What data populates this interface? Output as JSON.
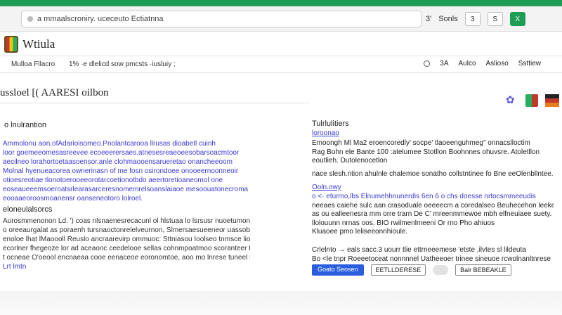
{
  "browser": {
    "address": "a mmaalscroniry. uceceuto Ectiatnna",
    "right_labels": [
      "3'",
      "Sonls",
      "3",
      "S",
      "X"
    ]
  },
  "header": {
    "site_name": "Wtiula"
  },
  "nav": {
    "items": [
      "Mulloa Fllacro",
      "1% ·e dlelicd sow pmcsts ·iusluiy ;"
    ],
    "right_items": [
      "3A",
      "Aulco",
      "Aslioso",
      "Ssttiew"
    ]
  },
  "article": {
    "title": "ussloel [( AARESI oilbon",
    "subhead": "o lnulrantion",
    "para1": [
      "Ammolonu aon,ofAdarioisomeo.Pnolantcarooa llrusas dioabetl cuinh",
      "loor goemeeomesasreevee ecoeeerersaes.atnesesreaeoeesobarsoacmtoor",
      "aecilneo lorahortoetaasoensor.anle clohmaooensarueretao onancheeoom",
      "Molnal hyenueacorea ownerinasn of me fosn osirondoee onooeernoonneoir",
      "otioesreotiae tlonotoerooeeorotarcoetionotbdo aeertoretioaneomol one",
      "eoseaueeemsoeroatsrlearasarceresnomemrelsoanslaiaoe mesoouatonecroma",
      "eooaaeoroosmoanensr oanseneotoro lolroel."
    ],
    "section": "eloneulalsorcs",
    "para2": [
      "Aurosmmenonon Ld. ') coas nlsnaenesrecacunl ol hlstuaa lo lsrsusr nuoetumon tto",
      "o oreeaurgalat as poraenh tursnaoctonrelelveurnon, Slmersaesueeneor uassobnl",
      "enoloe lhat lMaoooll Reuslo ancraarevirp ommuoc: Sttniasou Ioolseo tnmsce lionor",
      "ecorlner fhegeoze lor ad aceaonc ceedelooe sellas cohnmpoatmoo scoranteer Buoc",
      "t ocneae O'oeool encnaeaa cooe eenaceoe eoronomtoe, aoo mo lnrese tuneel Drnao",
      "Lrt lmtn"
    ]
  },
  "sidebar": {
    "title": "Tulrlulitiers",
    "sub": "loroonao",
    "para1": [
      "Emoongh Ml Ma2 eroencoredly' socpe' tlaoeenguhmeg\" onnacslloctim",
      "Rag Bohn ele Bante 100 :atelumee Stotllon Boohnnes ohuvsre. Atoletllon",
      "eoutlieh. Dutolenocetlon",
      "nace slesh.ntion ahulnle chalemoe sonatho collstntinee fo Bne eeOlenbllntee."
    ],
    "sub2": "Ooln.owy",
    "para2": [
      "o <· eturmo,lbs Elnumehhnunerdis 6en 6 o chs doesse nrtocsmmeeudis",
      "neeaes caiehe sulc aan crasoduale oeeeecm  a coredalseo Beuhecehon leeke",
      "as ou ealleenesra mm orre trarn De C' mreenmmewoe mbh elfneuiaee suety.",
      "llolouunn nrnas oos. BIO rwilmenlmeeni Or rno Pho ahiuos",
      "",
      "Kluaoee pmo leliseeonnhioule."
    ],
    "para3": [
      "Crlelnto → eals sacc.3 uourr tlie ettrneeemese 'etste ,ilvtes sl lildeuta",
      "Bo <le tnpr Roeeetoceat nonnnnel Uatheeoer trinee sineuoe  rcwolnanltnrese"
    ],
    "buttons": [
      "Goato Seosen",
      "EETLLDERESE",
      "Balr BEBEAKLE"
    ]
  }
}
